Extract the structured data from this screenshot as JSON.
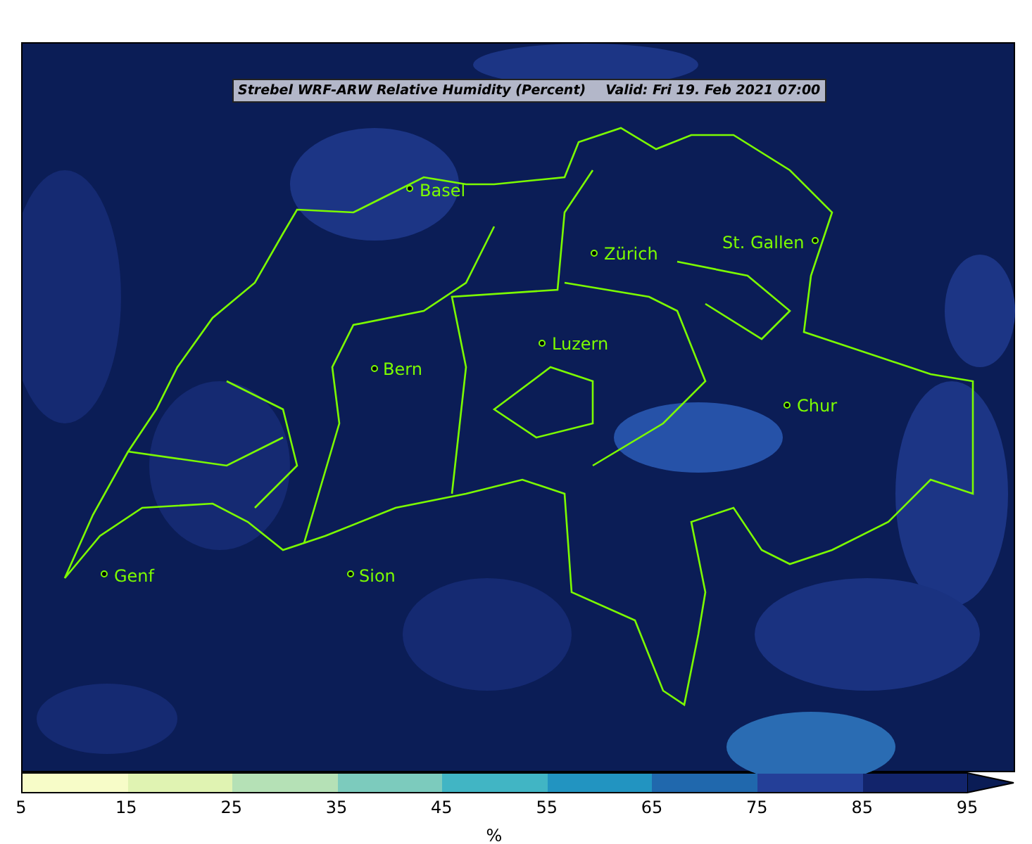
{
  "map": {
    "title": "Strebel WRF-ARW Relative Humidity (Percent)",
    "valid": "Valid: Fri 19. Feb 2021 07:00",
    "cities": [
      {
        "name": "Basel"
      },
      {
        "name": "Zürich"
      },
      {
        "name": "St. Gallen"
      },
      {
        "name": "Luzern"
      },
      {
        "name": "Bern"
      },
      {
        "name": "Chur"
      },
      {
        "name": "Genf"
      },
      {
        "name": "Sion"
      }
    ]
  },
  "colorbar": {
    "segments": [
      {
        "color": "#f7fcc8"
      },
      {
        "color": "#e0f3b2"
      },
      {
        "color": "#b5e1b6"
      },
      {
        "color": "#7ccbbd"
      },
      {
        "color": "#41b5c4"
      },
      {
        "color": "#2294c1"
      },
      {
        "color": "#2068ad"
      },
      {
        "color": "#243f98"
      },
      {
        "color": "#12246b"
      },
      {
        "kind": "extension",
        "color": "#0a1c55"
      }
    ],
    "ticks": [
      "5",
      "15",
      "25",
      "35",
      "45",
      "55",
      "65",
      "75",
      "85",
      "95"
    ],
    "label": "%"
  }
}
